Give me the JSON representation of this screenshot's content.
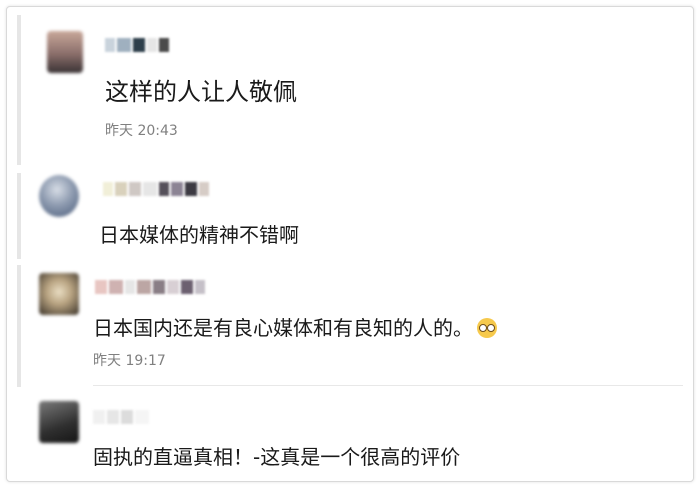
{
  "comments": [
    {
      "text": "这样的人让人敬佩",
      "time": "昨天 20:43"
    },
    {
      "text": "日本媒体的精神不错啊"
    },
    {
      "text": "日本国内还是有良心媒体和有良知的人的。",
      "time": "昨天 19:17",
      "emoji": "glasses-emoji"
    },
    {
      "text": "固执的直逼真相！-这真是一个很高的评价"
    }
  ],
  "colors": {
    "text": "#1a1a1a",
    "time": "#808080",
    "bar": "#e6e6e6",
    "border": "#d9d9d9"
  }
}
